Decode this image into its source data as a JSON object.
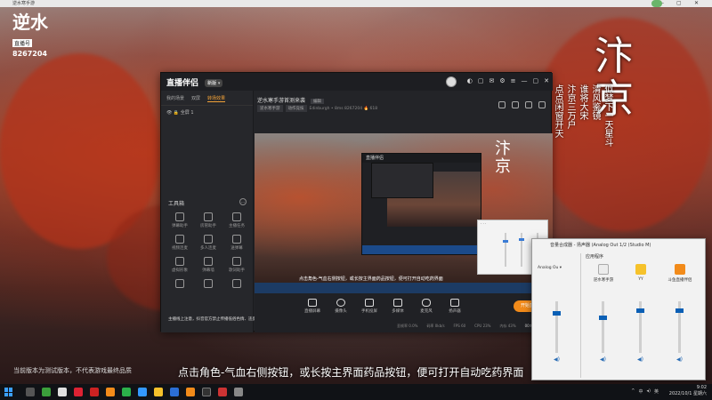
{
  "top_bar": {
    "title": "逆水寒手游"
  },
  "overlay": {
    "logo_glyph": "逆水",
    "logo_tag": "直播号",
    "room_id": "8267204",
    "big_title": "汴京",
    "poem_lines": [
      "似梦下一天星斗",
      "清风鉴镜",
      "谁将大宋",
      "汴京三万户",
      "点点闲窗开天"
    ],
    "bottom_note": "当前版本为测试版本，不代表游戏最终品质",
    "subtitle": "点击角色-气血右侧按钮，或长按主界面药品按钮，便可打开自动吃药界面"
  },
  "app": {
    "brand": "直播伴侣",
    "brand_badge": "新版 ▾",
    "title_icons": [
      "◐",
      "▢",
      "✉",
      "⚙",
      "≡",
      "—",
      "▢",
      "✕"
    ],
    "sidebar": {
      "tabs": [
        "我的场景",
        "双屏",
        "转场效果"
      ],
      "active_tab": 2,
      "scene_row": "👁  🔒  全屏 1",
      "tools_title": "工具箱",
      "tools": [
        "弹幕助手",
        "房管助手",
        "主播任务",
        "视频连麦",
        "多人连麦",
        "送弹幕",
        "虚拟形象",
        "弹幕墙",
        "歌词助手",
        "",
        "",
        ""
      ],
      "footer": "主播线上注意，抖音官方禁止传播低俗色情、违反社会公德内容，违者将被封号"
    },
    "room": {
      "title": "逆水寒手游首测来袭",
      "edit_label": "编辑",
      "chips": [
        "逆水寒手游",
        "动作竞技"
      ],
      "meta": "Edinburgh • 8ms  8267204  🔥 618"
    },
    "preview": {
      "title": "汴京",
      "caption": "点击角色-气血右侧按钮，或长按主界面药品按钮，便可打开自动吃药界面",
      "inner_window_title": "直播伴侣"
    },
    "controls": {
      "buttons": [
        "直播屏幕",
        "摄像头",
        "手机投屏",
        "多媒体",
        "麦克风",
        "扬声器"
      ],
      "start_label": "开始直播",
      "status": [
        "丢帧率 0.0%",
        "码率 0kb/s",
        "FPS 60",
        "CPU 23%",
        "内存 43%"
      ],
      "time": "00:00:00"
    }
  },
  "mixer": {
    "title": "音量合成器 - 扬声器 (Analog Out 1/2 (Studio M)",
    "apps_label": "应用程序",
    "device_label": "Analog Ou ▾",
    "columns": [
      {
        "name": "逆水寒手游",
        "color": "#f0f0f0",
        "level": 0.7
      },
      {
        "name": "YY",
        "color": "#f6c22b",
        "level": 0.85
      },
      {
        "name": "斗鱼直播伴侣",
        "color": "#f28b1a",
        "level": 0.85
      }
    ],
    "device_level": 0.8
  },
  "taskbar": {
    "time": "9:02",
    "date": "2022/10/1 星期六",
    "tray": [
      "^",
      "中",
      "◂)",
      "英"
    ]
  }
}
